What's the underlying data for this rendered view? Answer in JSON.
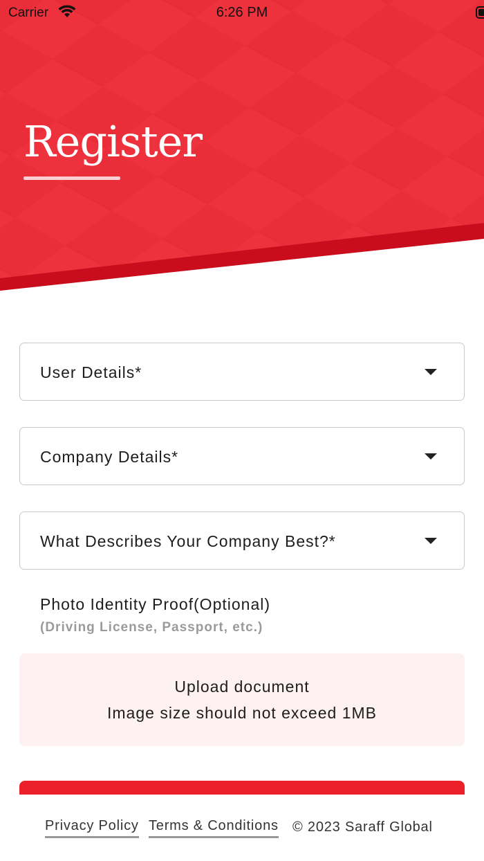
{
  "status_bar": {
    "carrier": "Carrier",
    "time": "6:26 PM",
    "wifi_icon": "wifi-icon",
    "battery_icon": "battery-icon"
  },
  "header": {
    "title": "Register",
    "accent_color": "#ea2e39",
    "dark_band_color": "#c90d1c"
  },
  "form": {
    "user_details": "User Details*",
    "company_details": "Company Details*",
    "company_description": "What Describes Your Company Best?*",
    "photo_id_title": "Photo Identity Proof(Optional)",
    "photo_id_hint": "(Driving License, Passport, etc.)",
    "upload_label": "Upload document",
    "upload_limit": "Image size should not exceed 1MB",
    "dropdown_icon": "caret-down-icon"
  },
  "footer": {
    "privacy": "Privacy Policy",
    "terms": "Terms & Conditions",
    "copyright": "© 2023 Saraff Global"
  }
}
